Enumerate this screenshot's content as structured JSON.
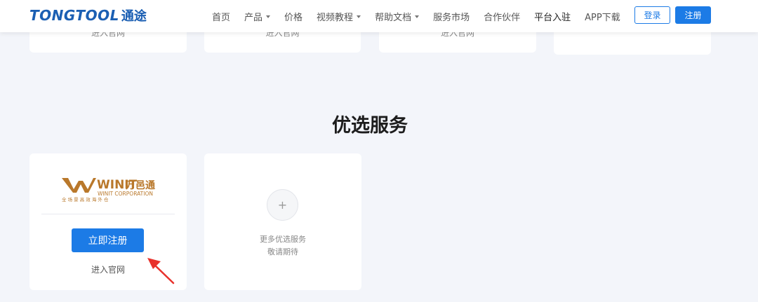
{
  "header": {
    "logo_en": "TONGTOOL",
    "logo_cn": "通途",
    "nav": [
      {
        "label": "首页",
        "dropdown": false,
        "active": false
      },
      {
        "label": "产品",
        "dropdown": true,
        "active": false
      },
      {
        "label": "价格",
        "dropdown": false,
        "active": false
      },
      {
        "label": "视频教程",
        "dropdown": true,
        "active": false
      },
      {
        "label": "帮助文档",
        "dropdown": true,
        "active": false
      },
      {
        "label": "服务市场",
        "dropdown": false,
        "active": false
      },
      {
        "label": "合作伙伴",
        "dropdown": false,
        "active": false
      },
      {
        "label": "平台入驻",
        "dropdown": false,
        "active": true
      },
      {
        "label": "APP下载",
        "dropdown": false,
        "active": false
      }
    ],
    "login_label": "登录",
    "register_label": "注册"
  },
  "top_cards": [
    {
      "text": "进入官网"
    },
    {
      "text": "进入官网"
    },
    {
      "text": "进入官网"
    },
    {
      "text": ""
    }
  ],
  "section": {
    "title": "优选服务"
  },
  "services": {
    "winit": {
      "logo_text": "WINIT",
      "logo_cn": "万邑通",
      "logo_sub": "WINIT CORPORATION",
      "logo_tagline": "全 场 景 高 效 海 外 仓",
      "signup_label": "立即注册",
      "visit_label": "进入官网"
    },
    "more": {
      "line1": "更多优选服务",
      "line2": "敬请期待"
    }
  },
  "colors": {
    "primary": "#1c7be6",
    "logo_blue": "#1b5fb3",
    "winit_gold": "#b9782b",
    "arrow_red": "#e8322c",
    "background": "#f3f5fa"
  }
}
